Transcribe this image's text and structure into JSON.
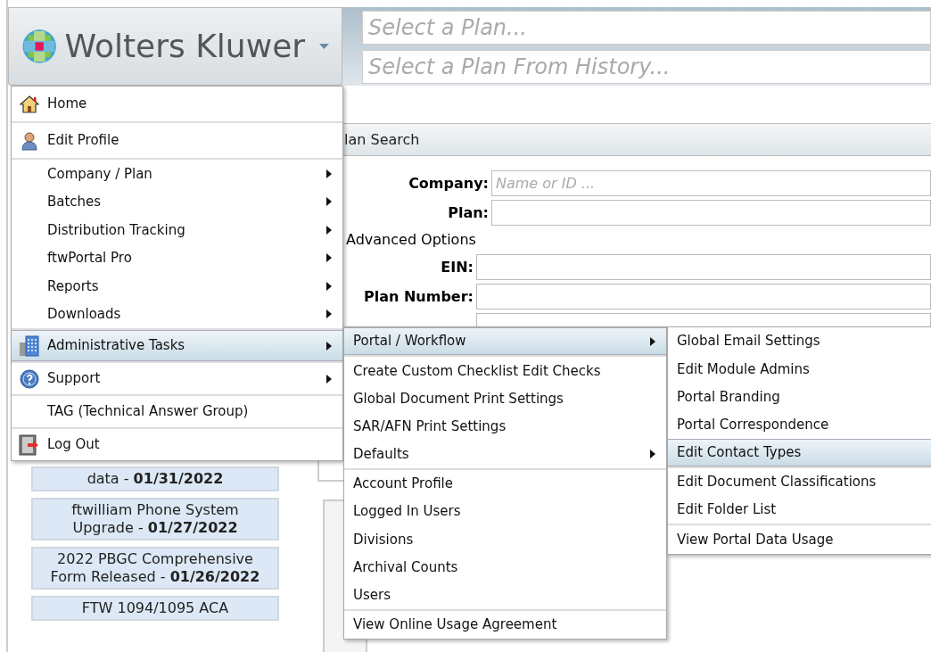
{
  "header": {
    "logo": "Wolters Kluwer",
    "plan_select": {
      "placeholder": "Select a Plan..."
    },
    "history_select": {
      "placeholder": "Select a Plan From History..."
    }
  },
  "plan_search": {
    "title": "lan Search",
    "fields": [
      {
        "label": "Company:",
        "placeholder": "Name or ID ..."
      },
      {
        "label": "Plan:"
      }
    ],
    "advanced": "Advanced Options",
    "advanced_fields": [
      {
        "label": "EIN:"
      },
      {
        "label": "Plan Number:"
      }
    ]
  },
  "news": [
    {
      "text": "data - **01/31/2022**"
    },
    {
      "text": "ftwilliam Phone System Upgrade - **01/27/2022**"
    },
    {
      "text": "2022 PBGC Comprehensive Form Released - **01/26/2022**"
    },
    {
      "text": "FTW 1094/1095 ACA"
    }
  ],
  "main_menu": [
    [
      {
        "label": "Home",
        "kind": "home",
        "submenu": false,
        "selected": false
      }
    ],
    [
      {
        "label": "Edit Profile",
        "kind": "person",
        "submenu": false,
        "selected": false
      }
    ],
    [
      {
        "label": "Company / Plan",
        "submenu": true,
        "selected": false
      },
      {
        "label": "Batches",
        "submenu": true,
        "selected": false
      },
      {
        "label": "Distribution Tracking",
        "submenu": true,
        "selected": false
      },
      {
        "label": "ftwPortal Pro",
        "submenu": true,
        "selected": false
      },
      {
        "label": "Reports",
        "submenu": true,
        "selected": false
      },
      {
        "label": "Downloads",
        "submenu": true,
        "selected": false
      }
    ],
    [
      {
        "label": "Administrative Tasks",
        "kind": "building",
        "submenu": true,
        "selected": true
      }
    ],
    [
      {
        "label": "Support",
        "kind": "help",
        "submenu": true,
        "selected": false
      }
    ],
    [
      {
        "label": "TAG (Technical Answer Group)",
        "submenu": false,
        "selected": false
      }
    ],
    [
      {
        "label": "Log Out",
        "kind": "logout",
        "submenu": false,
        "selected": false
      }
    ]
  ],
  "admin_menu": [
    [
      {
        "label": "Portal / Workflow",
        "submenu": true,
        "selected": true
      }
    ],
    [
      {
        "label": "Create Custom Checklist Edit Checks",
        "submenu": false,
        "selected": false
      },
      {
        "label": "Global Document Print Settings",
        "submenu": false,
        "selected": false
      },
      {
        "label": "SAR/AFN Print Settings",
        "submenu": false,
        "selected": false
      },
      {
        "label": "Defaults",
        "submenu": true,
        "selected": false
      }
    ],
    [
      {
        "label": "Account Profile",
        "submenu": false,
        "selected": false
      },
      {
        "label": "Logged In Users",
        "submenu": false,
        "selected": false
      },
      {
        "label": "Divisions",
        "submenu": false,
        "selected": false
      },
      {
        "label": "Archival Counts",
        "submenu": false,
        "selected": false
      },
      {
        "label": "Users",
        "submenu": false,
        "selected": false
      }
    ],
    [
      {
        "label": "View Online Usage Agreement",
        "submenu": false,
        "selected": false
      }
    ]
  ],
  "portal_menu": [
    [
      {
        "label": "Global Email Settings",
        "submenu": false,
        "selected": false
      },
      {
        "label": "Edit Module Admins",
        "submenu": false,
        "selected": false
      },
      {
        "label": "Portal Branding",
        "submenu": false,
        "selected": false
      },
      {
        "label": "Portal Correspondence",
        "submenu": false,
        "selected": false
      },
      {
        "label": "Edit Contact Types",
        "submenu": false,
        "selected": true
      }
    ],
    [
      {
        "label": "Edit Document Classifications",
        "submenu": false,
        "selected": false
      },
      {
        "label": "Edit Folder List",
        "submenu": false,
        "selected": false
      }
    ],
    [
      {
        "label": "View Portal Data Usage",
        "submenu": false,
        "selected": false
      }
    ]
  ]
}
